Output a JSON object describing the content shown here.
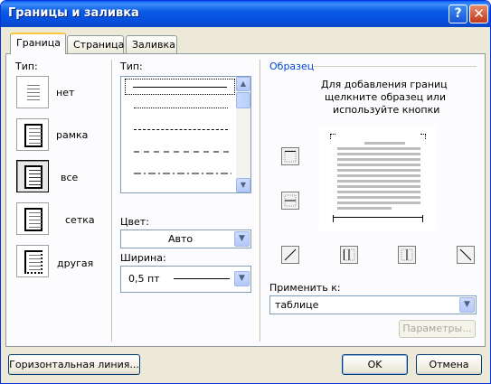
{
  "window": {
    "title": "Границы и заливка",
    "help_label": "?",
    "close_label": "✕"
  },
  "tabs": [
    {
      "label": "Граница",
      "active": true
    },
    {
      "label": "Страница",
      "active": false
    },
    {
      "label": "Заливка",
      "active": false
    }
  ],
  "type_section": {
    "label": "Тип:",
    "presets": [
      {
        "label": "нет",
        "icon": "no-border-icon"
      },
      {
        "label": "рамка",
        "icon": "box-border-icon"
      },
      {
        "label": "все",
        "icon": "all-borders-icon",
        "selected": true
      },
      {
        "label": "сетка",
        "icon": "grid-border-icon"
      },
      {
        "label": "другая",
        "icon": "custom-border-icon"
      }
    ]
  },
  "style_section": {
    "label": "Тип:",
    "line_styles": [
      "solid",
      "dotted",
      "dashed-small",
      "dashed",
      "dash-dot"
    ],
    "color_label": "Цвет:",
    "color_value": "Авто",
    "width_label": "Ширина:",
    "width_value": "0,5 пт"
  },
  "preview_section": {
    "label": "Образец",
    "hint": [
      "Для добавления границ",
      "щелкните образец или",
      "используйте кнопки"
    ],
    "apply_label": "Применить к:",
    "apply_value": "таблице",
    "options_button": "Параметры..."
  },
  "footer": {
    "horizontal_line_button": "Горизонтальная линия...",
    "ok_button": "OK",
    "cancel_button": "Отмена"
  },
  "colors": {
    "title_bar": "#0a5ef8",
    "dialog_bg": "#ece9d8",
    "tab_highlight": "#ffc83c",
    "field_border": "#7f9db9"
  }
}
